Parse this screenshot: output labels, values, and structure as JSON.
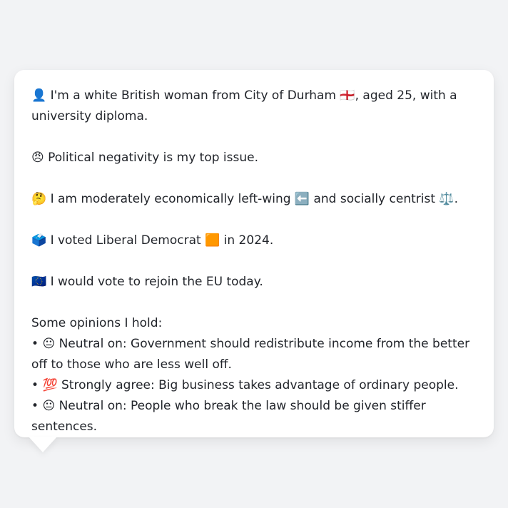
{
  "profile": {
    "identity": {
      "icon": "👤",
      "text": "I'm a white British woman from City of Durham 🏴󠁧󠁢󠁥󠁮󠁧󠁿, aged 25, with a university diploma."
    },
    "top_issue": {
      "icon": "😠",
      "text": "Political negativity is my top issue."
    },
    "ideology": {
      "icon": "🤔",
      "text": "I am moderately economically left-wing ⬅️ and socially centrist ⚖️."
    },
    "vote": {
      "icon": "🗳️",
      "text": "I voted Liberal Democrat 🟧 in 2024."
    },
    "eu": {
      "icon": "🇪🇺",
      "text": "I would vote to rejoin the EU today."
    },
    "opinions_heading": "Some opinions I hold:",
    "opinions": [
      {
        "bullet": "•",
        "icon": "😐",
        "text": "Neutral on: Government should redistribute income from the better off to those who are less well off."
      },
      {
        "bullet": "•",
        "icon": "💯",
        "text": "Strongly agree: Big business takes advantage of ordinary people."
      },
      {
        "bullet": "•",
        "icon": "😐",
        "text": "Neutral on: People who break the law should be given stiffer sentences."
      }
    ]
  }
}
